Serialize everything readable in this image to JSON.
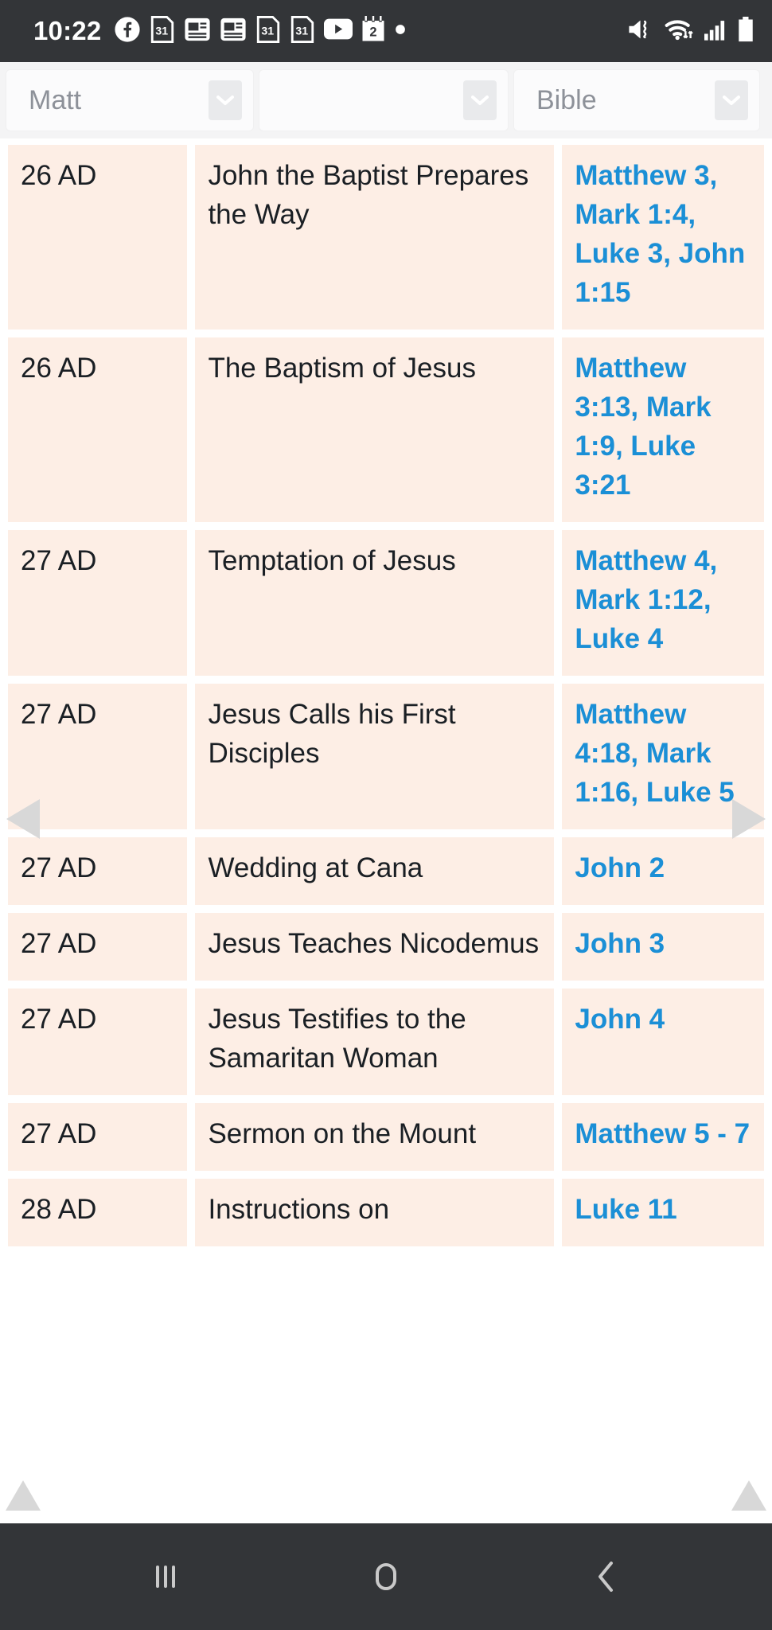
{
  "status_bar": {
    "clock": "10:22",
    "left_icons": [
      "facebook-icon",
      "calendar-31-icon",
      "news-article-icon",
      "news-article-icon",
      "calendar-31-icon",
      "calendar-31-icon",
      "youtube-icon",
      "calendar-2-icon",
      "more-notifications-dot-icon"
    ],
    "right_icons": [
      "vibrate-mute-icon",
      "wifi-icon",
      "cellular-signal-icon",
      "battery-icon"
    ],
    "background_color": "#333538"
  },
  "selectors": [
    {
      "name": "book-select",
      "value": "Matt",
      "caret": "chevron-down-icon"
    },
    {
      "name": "chapter-select",
      "value": "",
      "caret": "chevron-down-icon"
    },
    {
      "name": "version-select",
      "value": "Bible",
      "caret": "chevron-down-icon"
    }
  ],
  "table": {
    "accent_link_color": "#1b8fd6",
    "cell_background": "#fdeee5",
    "rows": [
      {
        "date": "26 AD",
        "event": "John the Baptist Prepares the Way",
        "refs": "Matthew 3, Mark 1:4, Luke 3, John 1:15"
      },
      {
        "date": "26 AD",
        "event": "The Baptism of Jesus",
        "refs": "Matthew 3:13, Mark 1:9, Luke 3:21"
      },
      {
        "date": "27 AD",
        "event": "Temptation of Jesus",
        "refs": "Matthew 4, Mark 1:12, Luke 4"
      },
      {
        "date": "27 AD",
        "event": "Jesus Calls his First Disciples",
        "refs": "Matthew 4:18, Mark 1:16, Luke 5"
      },
      {
        "date": "27 AD",
        "event": "Wedding at Cana",
        "refs": "John 2"
      },
      {
        "date": "27 AD",
        "event": "Jesus Teaches Nicodemus",
        "refs": "John 3"
      },
      {
        "date": "27 AD",
        "event": "Jesus Testifies to the Samaritan Woman",
        "refs": "John 4"
      },
      {
        "date": "27 AD",
        "event": "Sermon on the Mount",
        "refs": "Matthew 5 - 7"
      },
      {
        "date": "28 AD",
        "event": "Instructions on",
        "refs": "Luke 11"
      }
    ]
  },
  "side_navigation": {
    "previous": "previous-page-arrow-icon",
    "next": "next-page-arrow-icon",
    "scroll_up_left": "scroll-up-arrow-icon",
    "scroll_up_right": "scroll-up-arrow-icon"
  },
  "nav_bar": {
    "recents": "recents-icon",
    "home": "home-icon",
    "back": "back-icon",
    "background_color": "#333538"
  }
}
